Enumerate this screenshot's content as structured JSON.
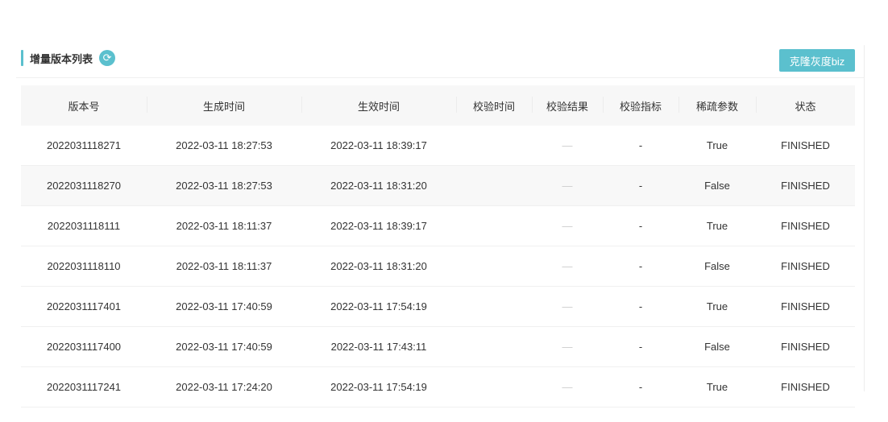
{
  "header": {
    "title": "增量版本列表",
    "refresh_icon": "refresh-icon",
    "clone_button": "克隆灰度biz"
  },
  "colors": {
    "accent": "#5bc0ce"
  },
  "table": {
    "columns": [
      "版本号",
      "生成时间",
      "生效时间",
      "校验时间",
      "校验结果",
      "校验指标",
      "稀疏参数",
      "状态"
    ],
    "rows": [
      [
        "2022031118271",
        "2022-03-11 18:27:53",
        "2022-03-11 18:39:17",
        "",
        "—",
        "-",
        "True",
        "FINISHED"
      ],
      [
        "2022031118270",
        "2022-03-11 18:27:53",
        "2022-03-11 18:31:20",
        "",
        "—",
        "-",
        "False",
        "FINISHED"
      ],
      [
        "2022031118111",
        "2022-03-11 18:11:37",
        "2022-03-11 18:39:17",
        "",
        "—",
        "-",
        "True",
        "FINISHED"
      ],
      [
        "2022031118110",
        "2022-03-11 18:11:37",
        "2022-03-11 18:31:20",
        "",
        "—",
        "-",
        "False",
        "FINISHED"
      ],
      [
        "2022031117401",
        "2022-03-11 17:40:59",
        "2022-03-11 17:54:19",
        "",
        "—",
        "-",
        "True",
        "FINISHED"
      ],
      [
        "2022031117400",
        "2022-03-11 17:40:59",
        "2022-03-11 17:43:11",
        "",
        "—",
        "-",
        "False",
        "FINISHED"
      ],
      [
        "2022031117241",
        "2022-03-11 17:24:20",
        "2022-03-11 17:54:19",
        "",
        "—",
        "-",
        "True",
        "FINISHED"
      ]
    ]
  }
}
